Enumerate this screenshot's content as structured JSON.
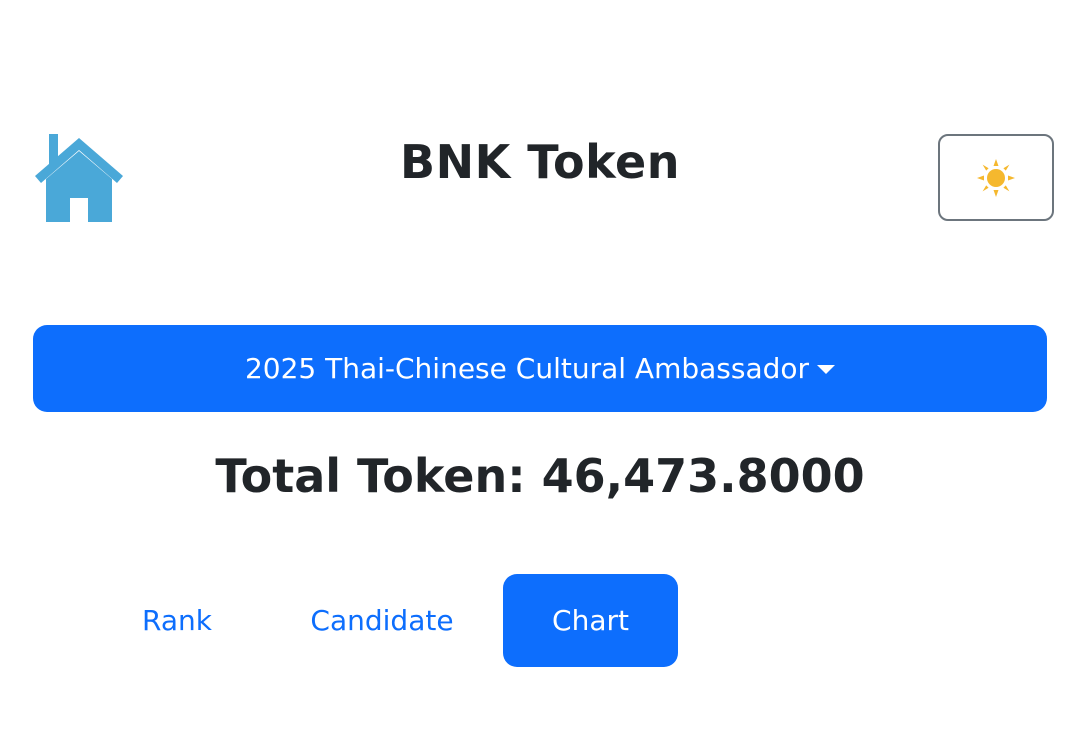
{
  "header": {
    "home_icon": "home-icon",
    "title": "BNK Token",
    "theme_toggle_icon": "sun-icon"
  },
  "selector": {
    "selected_event": "2025 Thai-Chinese Cultural Ambassador",
    "caret_icon": "caret-down-icon"
  },
  "summary": {
    "total_token_text": "Total Token: 46,473.8000"
  },
  "tabs": [
    {
      "label": "Rank",
      "active": false
    },
    {
      "label": "Candidate",
      "active": false
    },
    {
      "label": "Chart",
      "active": true
    }
  ],
  "colors": {
    "primary": "#0d6efd",
    "home_icon": "#4aa8d8",
    "sun": "#f5b82e",
    "toggle_border": "#6c757d",
    "text": "#212529"
  }
}
